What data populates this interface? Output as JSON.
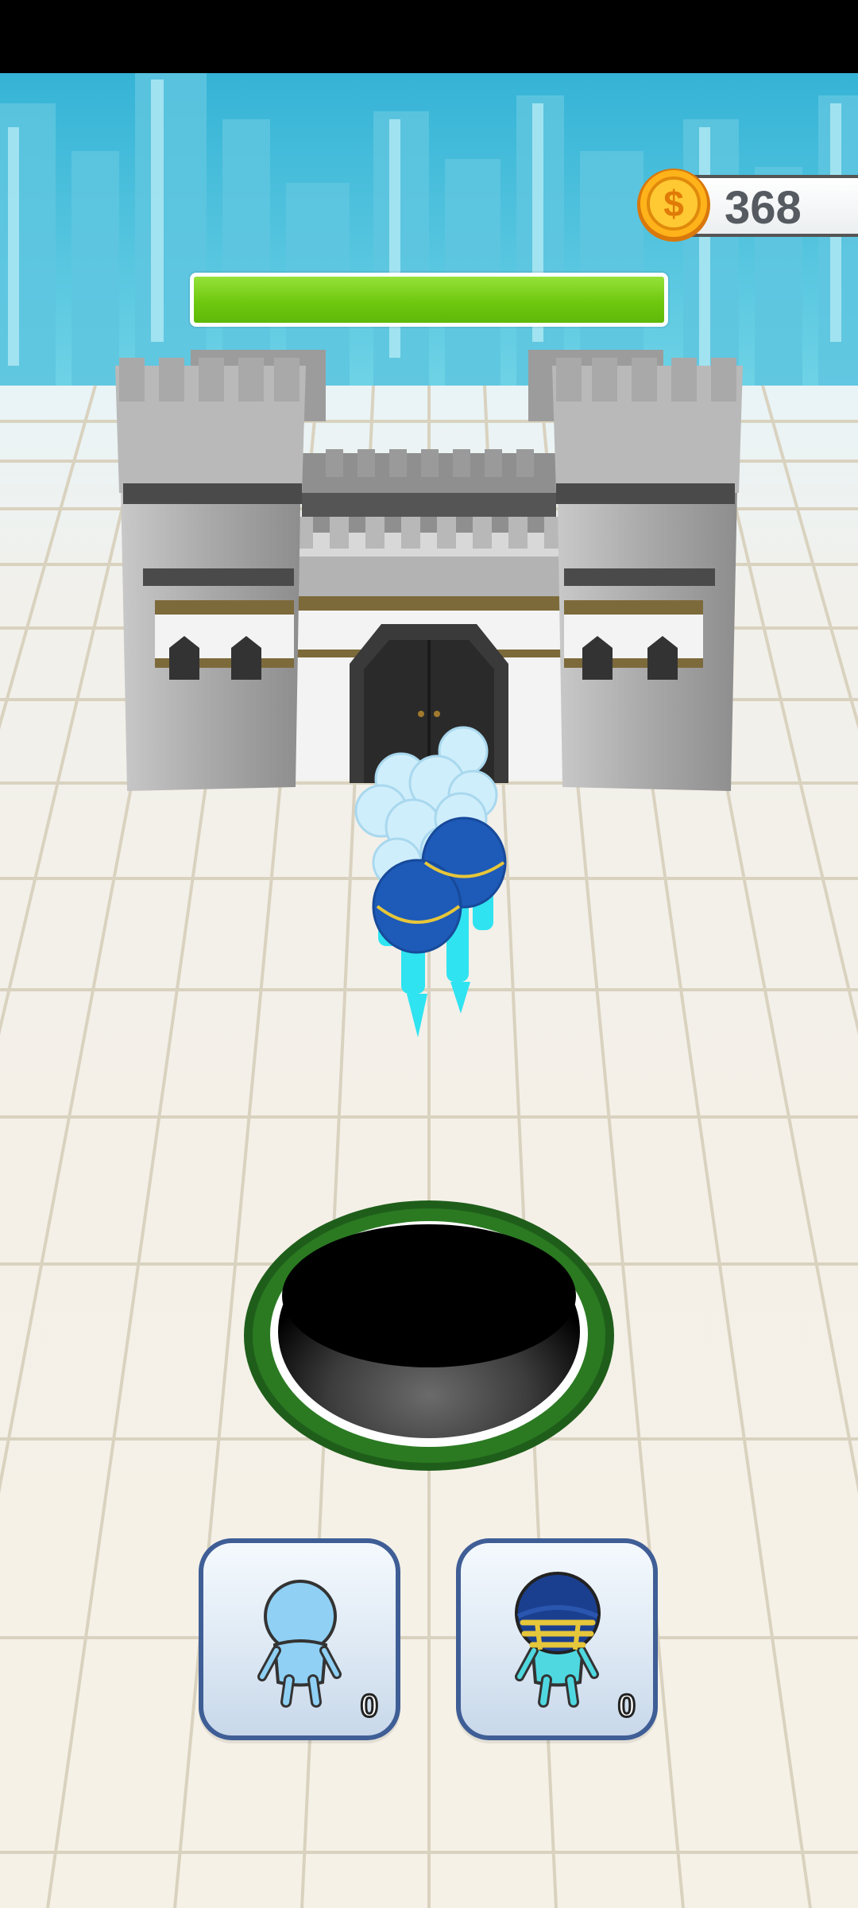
{
  "hud": {
    "coins": "368",
    "coin_icon": "dollar-coin-icon",
    "castle_health_fraction": 1.0
  },
  "spawn_buttons": [
    {
      "name": "basic-stickman",
      "count": "0",
      "icon": "light-blue-stickman-icon"
    },
    {
      "name": "helmet-stickman",
      "count": "0",
      "icon": "football-helmet-stickman-icon"
    }
  ],
  "colors": {
    "sky": "#3fb7d4",
    "health_green": "#72cb12",
    "hole_rim": "#1f5e1a",
    "button_border": "#3f5e96",
    "army_blue": "#1e5ab8",
    "army_cyan": "#2fe3f0"
  }
}
